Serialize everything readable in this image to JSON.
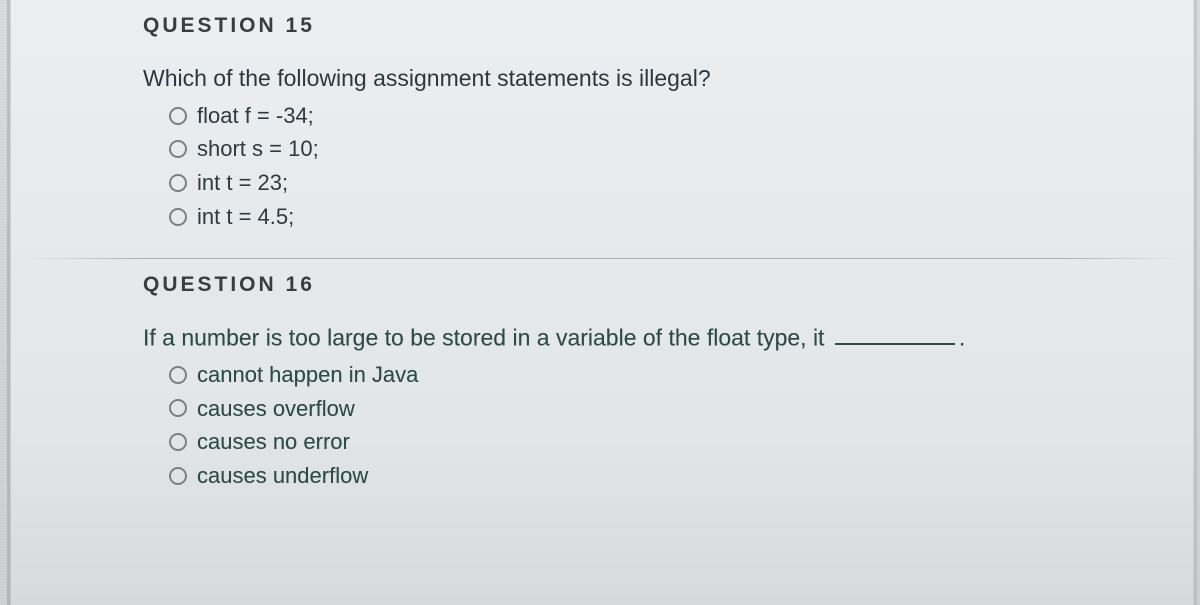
{
  "questions": [
    {
      "number": "QUESTION 15",
      "prompt": "Which of the following assignment statements is illegal?",
      "choices": [
        "float f = -34;",
        "short s = 10;",
        "int t = 23;",
        "int t = 4.5;"
      ]
    },
    {
      "number": "QUESTION 16",
      "prompt_prefix": "If a number is too large to be stored in a variable of the float type, it ",
      "prompt_suffix": ".",
      "choices": [
        "cannot happen in Java",
        "causes overflow",
        "causes no error",
        "causes underflow"
      ]
    }
  ]
}
